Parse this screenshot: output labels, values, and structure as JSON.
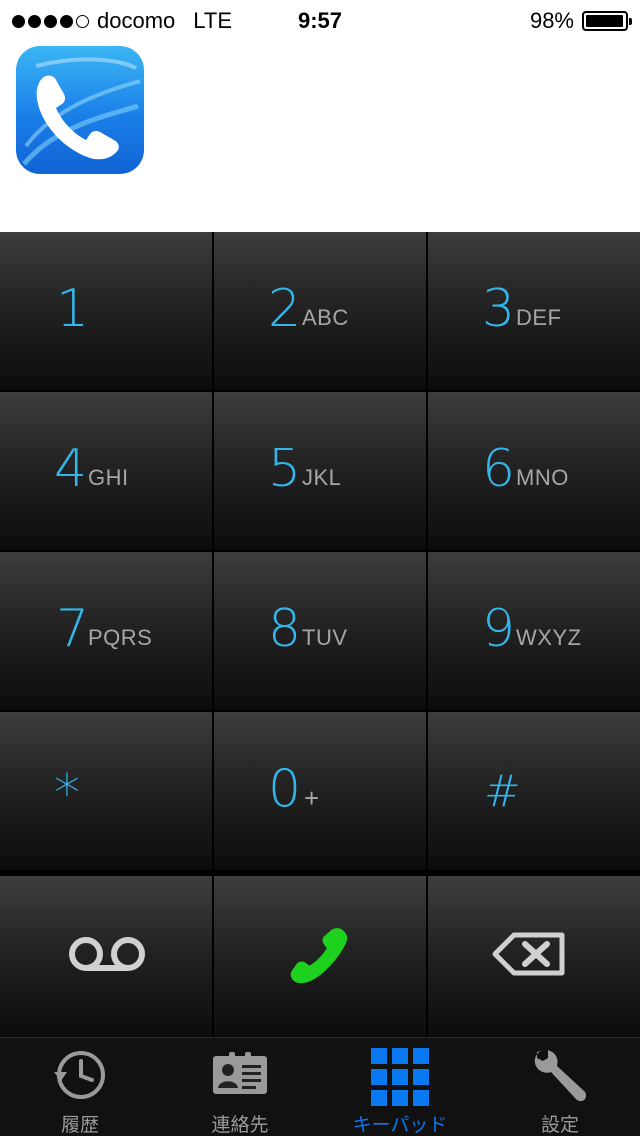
{
  "status_bar": {
    "carrier": "docomo",
    "network": "LTE",
    "time": "9:57",
    "battery": "98%",
    "signal_bars": 4,
    "signal_max": 5
  },
  "app": {
    "logo_icon": "phone-handset-logo-icon"
  },
  "keypad": {
    "digit_color": "#34b6ea",
    "letters_color": "#a6a6a6",
    "keys": [
      {
        "digit": "1",
        "letters": ""
      },
      {
        "digit": "2",
        "letters": "ABC"
      },
      {
        "digit": "3",
        "letters": "DEF"
      },
      {
        "digit": "4",
        "letters": "GHI"
      },
      {
        "digit": "5",
        "letters": "JKL"
      },
      {
        "digit": "6",
        "letters": "MNO"
      },
      {
        "digit": "7",
        "letters": "PQRS"
      },
      {
        "digit": "8",
        "letters": "TUV"
      },
      {
        "digit": "9",
        "letters": "WXYZ"
      },
      {
        "digit": "*",
        "letters": ""
      },
      {
        "digit": "0",
        "letters": "+"
      },
      {
        "digit": "#",
        "letters": ""
      }
    ],
    "actions": {
      "voicemail_icon": "voicemail-icon",
      "call_icon": "call-icon",
      "call_color": "#1fd11f",
      "delete_icon": "backspace-icon"
    }
  },
  "tabbar": {
    "active_color": "#0a78f0",
    "tabs": [
      {
        "label": "履歴",
        "icon": "history-clock-icon",
        "active": false
      },
      {
        "label": "連絡先",
        "icon": "contacts-card-icon",
        "active": false
      },
      {
        "label": "キーパッド",
        "icon": "keypad-grid-icon",
        "active": true
      },
      {
        "label": "設定",
        "icon": "wrench-icon",
        "active": false
      }
    ]
  }
}
